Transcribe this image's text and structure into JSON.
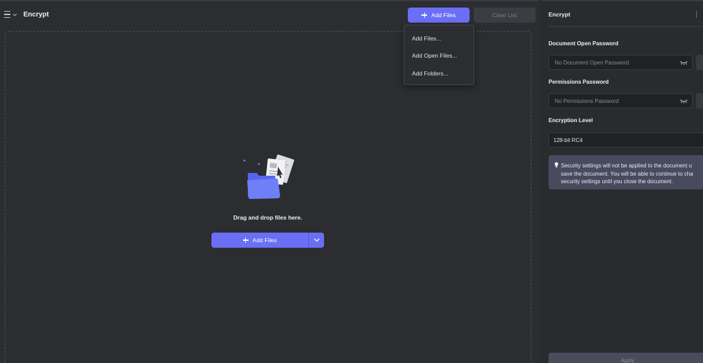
{
  "header": {
    "title": "Encrypt",
    "add_files_label": "Add Files",
    "clear_list_label": "Clear List"
  },
  "dropdown": {
    "items": [
      "Add Files...",
      "Add Open Files...",
      "Add Folders..."
    ]
  },
  "dropzone": {
    "hint": "Drag and drop files here.",
    "add_files_label": "Add Files"
  },
  "side_panel": {
    "title": "Encrypt",
    "open_password_label": "Document Open Password",
    "open_password_placeholder": "No Document Open Password",
    "permissions_password_label": "Permissions Password",
    "permissions_password_placeholder": "No Permissions Password",
    "encryption_level_label": "Encryption Level",
    "encryption_level_value": "128-bit RC4",
    "notice_line1": "Security settings will not be applied to the document u",
    "notice_line2": "save the document. You will be able to continue to cha",
    "notice_line3": "security settings until you close the document.",
    "apply_label": "Apply"
  },
  "colors": {
    "accent": "#6b6ff5",
    "background": "#2c2d31",
    "notice_bg": "#484a5e"
  }
}
